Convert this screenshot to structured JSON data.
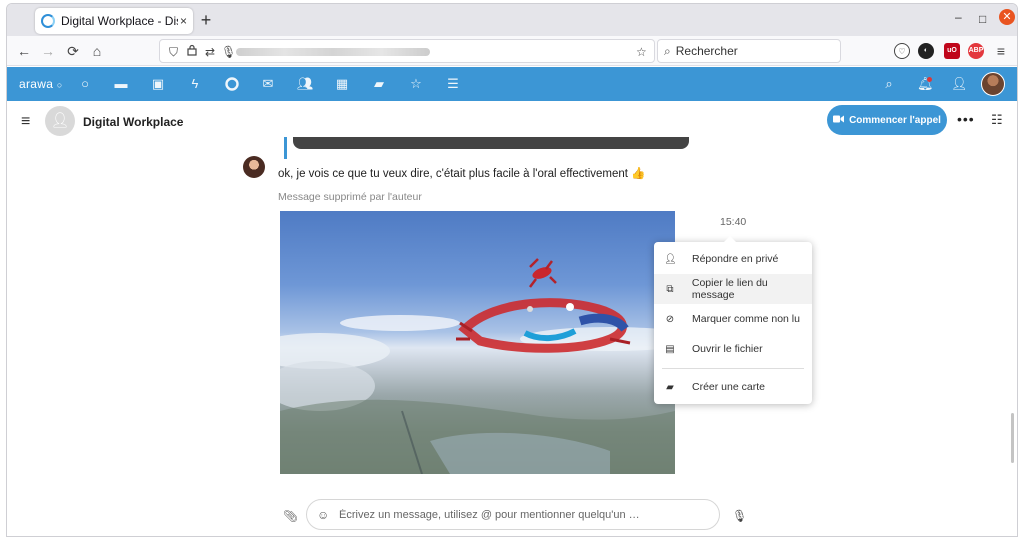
{
  "browser": {
    "tab_title": "Digital Workplace - Discu",
    "tab_close": "×",
    "new_tab": "+",
    "window_controls": {
      "minimize": "–",
      "maximize": "□",
      "close": "✕"
    },
    "search_placeholder": "Rechercher"
  },
  "app": {
    "logo": "arawa",
    "nav_icons": [
      "circle-dashboard-icon",
      "folder-icon",
      "image-icon",
      "activity-icon",
      "talk-icon",
      "mail-icon",
      "contacts-icon",
      "calendar-icon",
      "deck-icon",
      "star-app-icon",
      "notes-icon"
    ],
    "active_icon": "talk-icon",
    "accent_color": "#3c96d5"
  },
  "conversation": {
    "title": "Digital Workplace",
    "call_button": "Commencer l'appel",
    "more": "•••"
  },
  "messages": {
    "text": "ok, je vois ce que tu veux dire, c'était plus facile à l'oral effectivement 👍",
    "deleted": "Message supprimé par l'auteur",
    "time": "15:40"
  },
  "context_menu": {
    "items": [
      {
        "icon": "person-icon",
        "label": "Répondre en privé"
      },
      {
        "icon": "external-link-icon",
        "label": "Copier le lien du message"
      },
      {
        "icon": "eye-off-icon",
        "label": "Marquer comme non lu"
      },
      {
        "icon": "file-icon",
        "label": "Ouvrir le fichier"
      },
      {
        "icon": "deck-card-icon",
        "label": "Créer une carte"
      }
    ],
    "hovered_index": 1
  },
  "composer": {
    "placeholder": "Écrivez un message, utilisez @ pour mentionner quelqu'un …"
  }
}
